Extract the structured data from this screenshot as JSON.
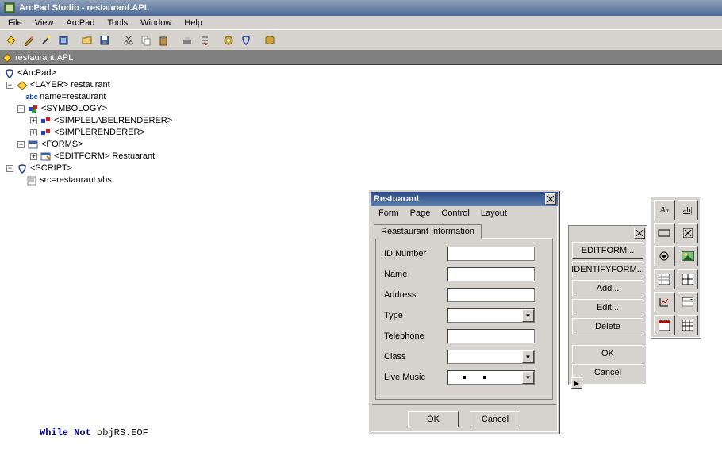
{
  "app": {
    "title": "ArcPad Studio - restaurant.APL"
  },
  "menubar": [
    "File",
    "View",
    "ArcPad",
    "Tools",
    "Window",
    "Help"
  ],
  "document_tab": "restaurant.APL",
  "tree": {
    "root": "<ArcPad>",
    "layer": "<LAYER> restaurant",
    "name_line": "name=restaurant",
    "abc": "abc",
    "symbology": "<SYMBOLOGY>",
    "slr": "<SIMPLELABELRENDERER>",
    "sr": "<SIMPLERENDERER>",
    "forms": "<FORMS>",
    "editform": "<EDITFORM> Restuarant",
    "script": "<SCRIPT>",
    "src": "src=restaurant.vbs"
  },
  "code": {
    "line": "While Not objRS.EOF"
  },
  "dialog": {
    "title": "Restuarant",
    "menus": [
      "Form",
      "Page",
      "Control",
      "Layout"
    ],
    "tab": "Reastaurant Information",
    "fields": {
      "id": "ID Number",
      "name": "Name",
      "address": "Address",
      "type": "Type",
      "tel": "Telephone",
      "class": "Class",
      "live": "Live Music"
    },
    "ok": "OK",
    "cancel": "Cancel"
  },
  "sidepane": {
    "editform": "EDITFORM...",
    "identifyform": "IDENTIFYFORM...",
    "add": "Add...",
    "edit": "Edit...",
    "delete": "Delete",
    "ok": "OK",
    "cancel": "Cancel"
  },
  "palette": [
    "Aa",
    "ab|",
    "▭",
    "☒",
    "◉",
    "img",
    "tbl",
    "grid",
    "chart",
    "▼",
    "cal",
    "▦"
  ]
}
